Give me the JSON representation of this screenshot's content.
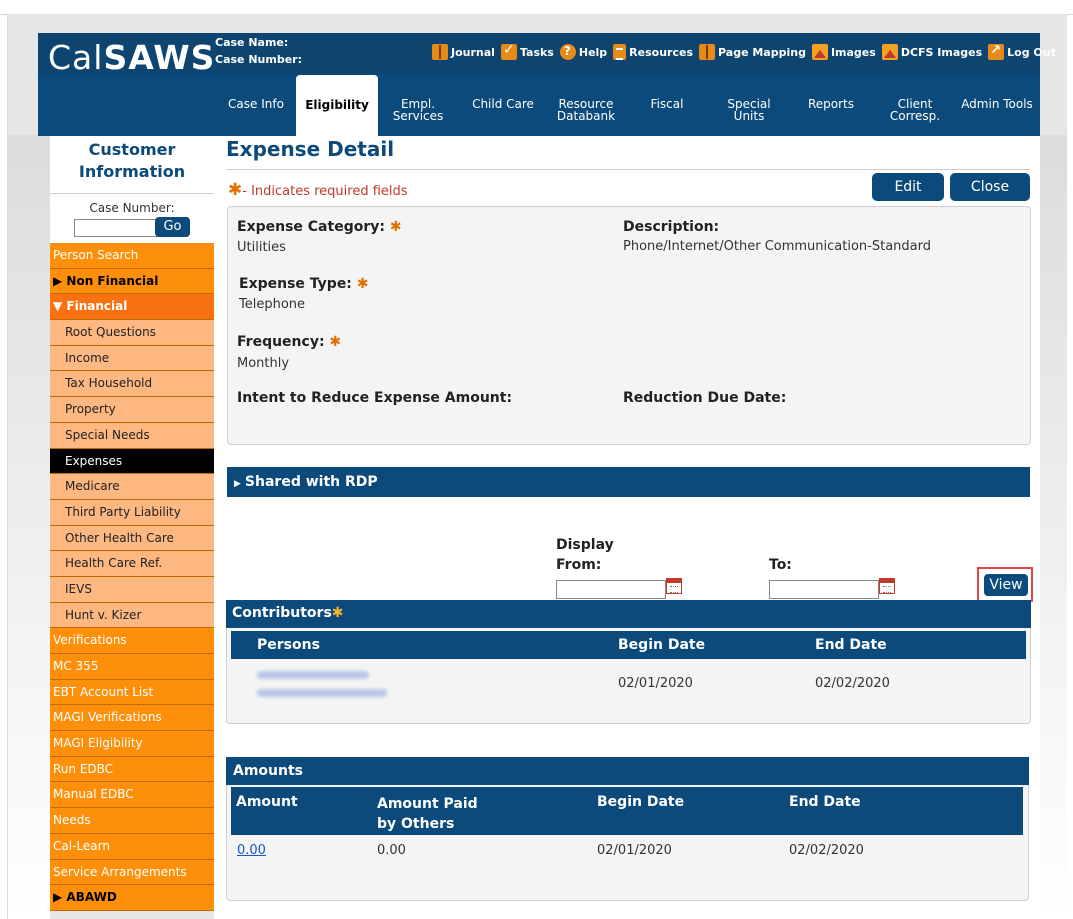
{
  "app": {
    "logo_light": "Cal",
    "logo_bold": "SAWS",
    "case_name_label": "Case Name:",
    "case_number_label": "Case Number:"
  },
  "toplinks": [
    {
      "label": "Journal",
      "icon": "journal-icon"
    },
    {
      "label": "Tasks",
      "icon": "tasks-icon"
    },
    {
      "label": "Help",
      "icon": "help-icon"
    },
    {
      "label": "Resources",
      "icon": "resources-icon"
    },
    {
      "label": "Page Mapping",
      "icon": "page-mapping-icon"
    },
    {
      "label": "Images",
      "icon": "images-icon"
    },
    {
      "label": "DCFS Images",
      "icon": "dcfs-images-icon"
    },
    {
      "label": "Log Out",
      "icon": "log-out-icon"
    }
  ],
  "nav": [
    {
      "l1": "Case Info",
      "l2": ""
    },
    {
      "l1": "Eligibility",
      "l2": ""
    },
    {
      "l1": "Empl.",
      "l2": "Services"
    },
    {
      "l1": "Child Care",
      "l2": ""
    },
    {
      "l1": "Resource",
      "l2": "Databank"
    },
    {
      "l1": "Fiscal",
      "l2": ""
    },
    {
      "l1": "Special",
      "l2": "Units"
    },
    {
      "l1": "Reports",
      "l2": ""
    },
    {
      "l1": "Client",
      "l2": "Corresp."
    },
    {
      "l1": "Admin Tools",
      "l2": ""
    }
  ],
  "sidebar": {
    "title1": "Customer",
    "title2": "Information",
    "case_number_label": "Case Number:",
    "go_label": "Go",
    "items": [
      {
        "label": "Person Search",
        "type": "l1"
      },
      {
        "label": "▶ Non Financial",
        "type": "sec"
      },
      {
        "label": "▼ Financial",
        "type": "sec-dark"
      },
      {
        "label": "Root Questions",
        "type": "l2"
      },
      {
        "label": "Income",
        "type": "l2"
      },
      {
        "label": "Tax Household",
        "type": "l2"
      },
      {
        "label": "Property",
        "type": "l2"
      },
      {
        "label": "Special Needs",
        "type": "l2"
      },
      {
        "label": "Expenses",
        "type": "active"
      },
      {
        "label": "Medicare",
        "type": "l2"
      },
      {
        "label": "Third Party Liability",
        "type": "l2"
      },
      {
        "label": "Other Health Care",
        "type": "l2"
      },
      {
        "label": "Health Care Ref.",
        "type": "l2"
      },
      {
        "label": "IEVS",
        "type": "l2"
      },
      {
        "label": "Hunt v. Kizer",
        "type": "l2"
      },
      {
        "label": "Verifications",
        "type": "l1"
      },
      {
        "label": "MC 355",
        "type": "l1"
      },
      {
        "label": "EBT Account List",
        "type": "l1"
      },
      {
        "label": "MAGI Verifications",
        "type": "l1"
      },
      {
        "label": "MAGI Eligibility",
        "type": "l1"
      },
      {
        "label": "Run EDBC",
        "type": "l1"
      },
      {
        "label": "Manual EDBC",
        "type": "l1"
      },
      {
        "label": "Needs",
        "type": "l1"
      },
      {
        "label": "Cal-Learn",
        "type": "l1"
      },
      {
        "label": "Service Arrangements",
        "type": "l1"
      },
      {
        "label": "▶ ABAWD",
        "type": "sec"
      }
    ]
  },
  "page": {
    "title": "Expense Detail",
    "required_note": "- Indicates required fields",
    "edit_label": "Edit",
    "close_label": "Close"
  },
  "detail": {
    "expense_category_label": "Expense Category:",
    "expense_category_value": "Utilities",
    "description_label": "Description:",
    "description_value": "Phone/Internet/Other Communication-Standard",
    "expense_type_label": "Expense Type:",
    "expense_type_value": "Telephone",
    "frequency_label": "Frequency:",
    "frequency_value": "Monthly",
    "intent_label": "Intent to Reduce Expense Amount:",
    "reduction_label": "Reduction Due Date:"
  },
  "shared_label": "Shared with RDP",
  "display": {
    "label": "Display",
    "from_label": "From:",
    "to_label": "To:",
    "view_label": "View"
  },
  "contributors": {
    "title": "Contributors",
    "headers": [
      "Persons",
      "Begin Date",
      "End Date"
    ],
    "begin_date": "02/01/2020",
    "end_date": "02/02/2020"
  },
  "amounts": {
    "title": "Amounts",
    "headers": [
      "Amount",
      "Amount Paid",
      "by Others",
      "Begin Date",
      "End Date"
    ],
    "row": {
      "amount": "0.00",
      "paid_by_others": "0.00",
      "begin": "02/01/2020",
      "end": "02/02/2020"
    }
  },
  "colors": {
    "brand": "#0b4a7a",
    "menu_orange": "#fe8f0a",
    "submenu_peach": "#fdb882",
    "required_star": "#e07000",
    "highlight_red": "#e04646"
  }
}
